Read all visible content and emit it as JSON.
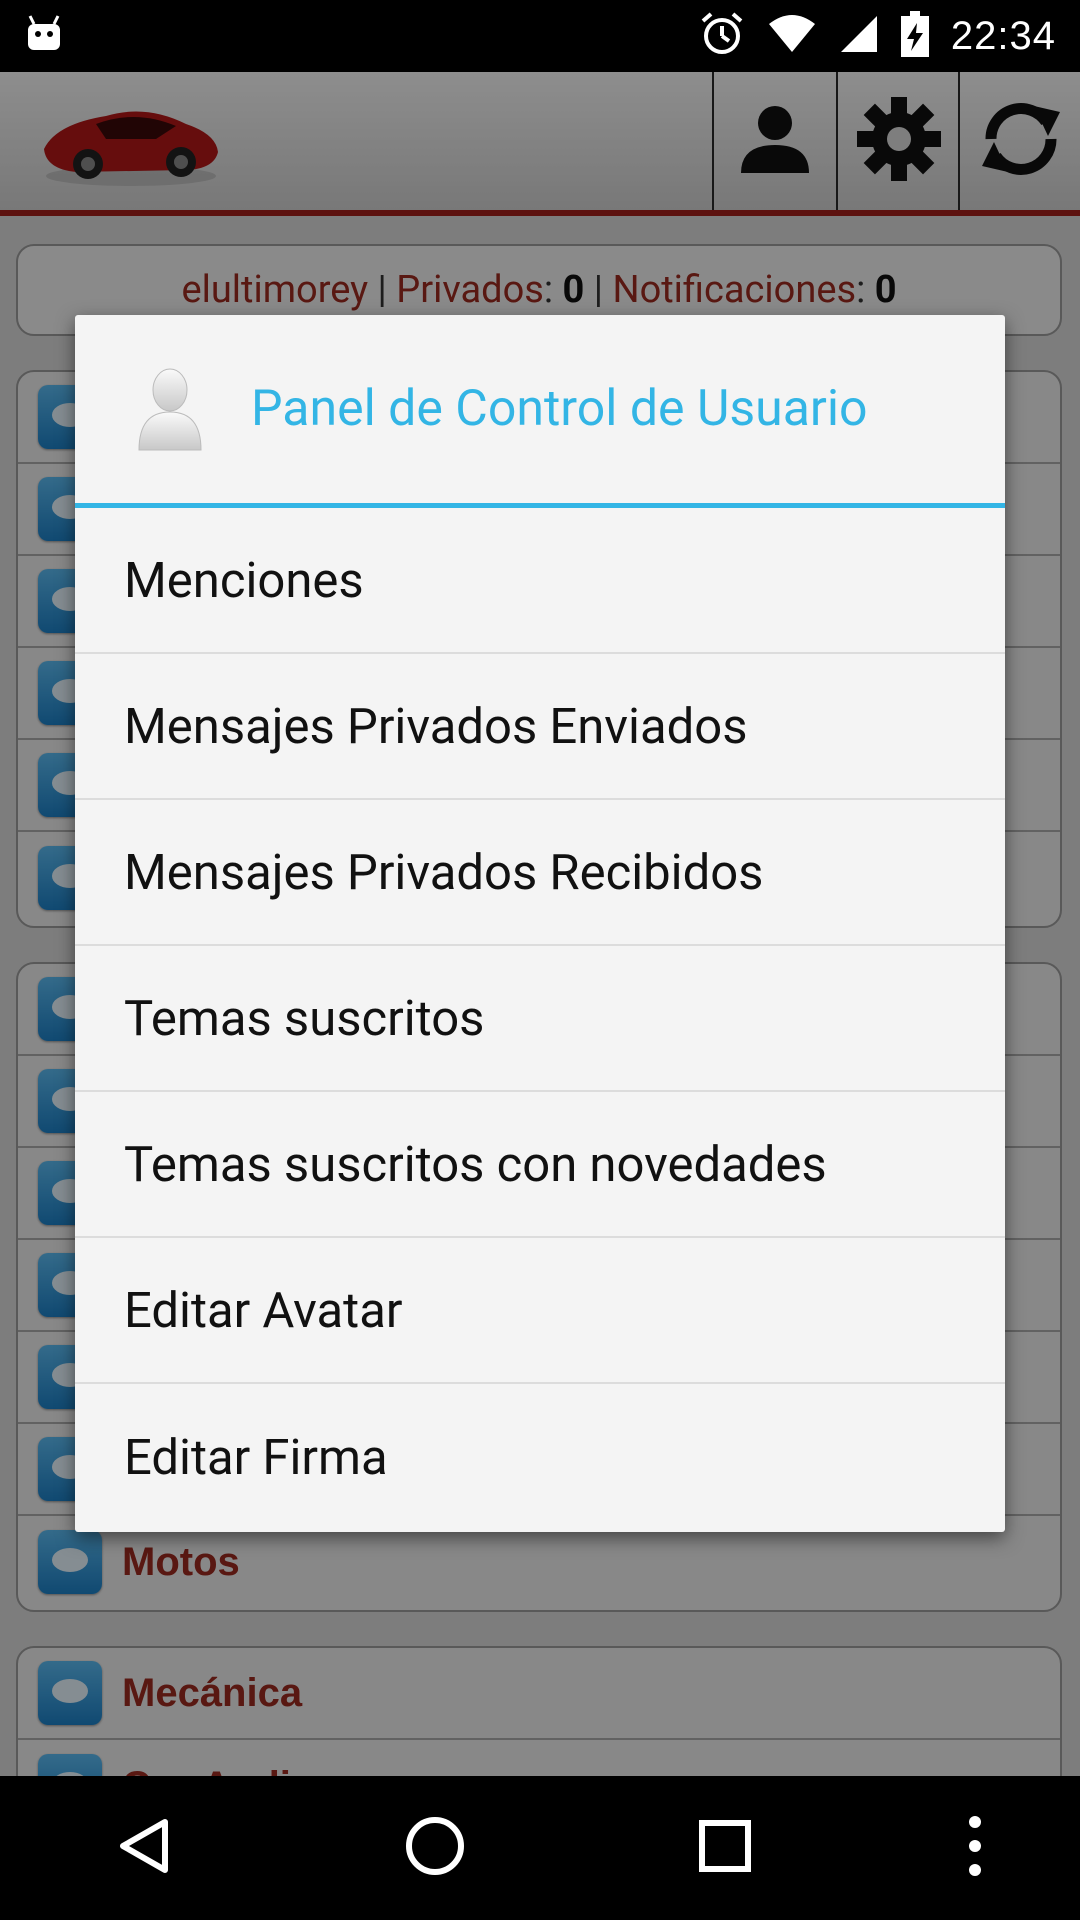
{
  "status_bar": {
    "time": "22:34",
    "icons": [
      "android-icon",
      "alarm-icon",
      "wifi-icon",
      "signal-icon",
      "battery-charging-icon"
    ]
  },
  "toolbar": {
    "logo": "red-car-logo",
    "buttons": [
      "user-icon",
      "gear-icon",
      "refresh-icon"
    ]
  },
  "user_bar": {
    "username": "elultimorey",
    "sep1": " | ",
    "privados_label": "Privados",
    "privados_count": "0",
    "sep2": " | ",
    "notificaciones_label": "Notificaciones",
    "notificaciones_count": "0",
    "colon": ": "
  },
  "forums": {
    "visible_titles": [
      "Motos",
      "Mecánica",
      "Car-Audio"
    ]
  },
  "dialog": {
    "title": "Panel de Control de Usuario",
    "items": [
      {
        "label": "Menciones"
      },
      {
        "label": "Mensajes Privados Enviados"
      },
      {
        "label": "Mensajes Privados Recibidos"
      },
      {
        "label": "Temas suscritos"
      },
      {
        "label": "Temas suscritos con novedades"
      },
      {
        "label": "Editar Avatar"
      },
      {
        "label": "Editar Firma"
      }
    ]
  },
  "colors": {
    "accent": "#33b5e5",
    "brand_red": "#9a2a1f"
  }
}
